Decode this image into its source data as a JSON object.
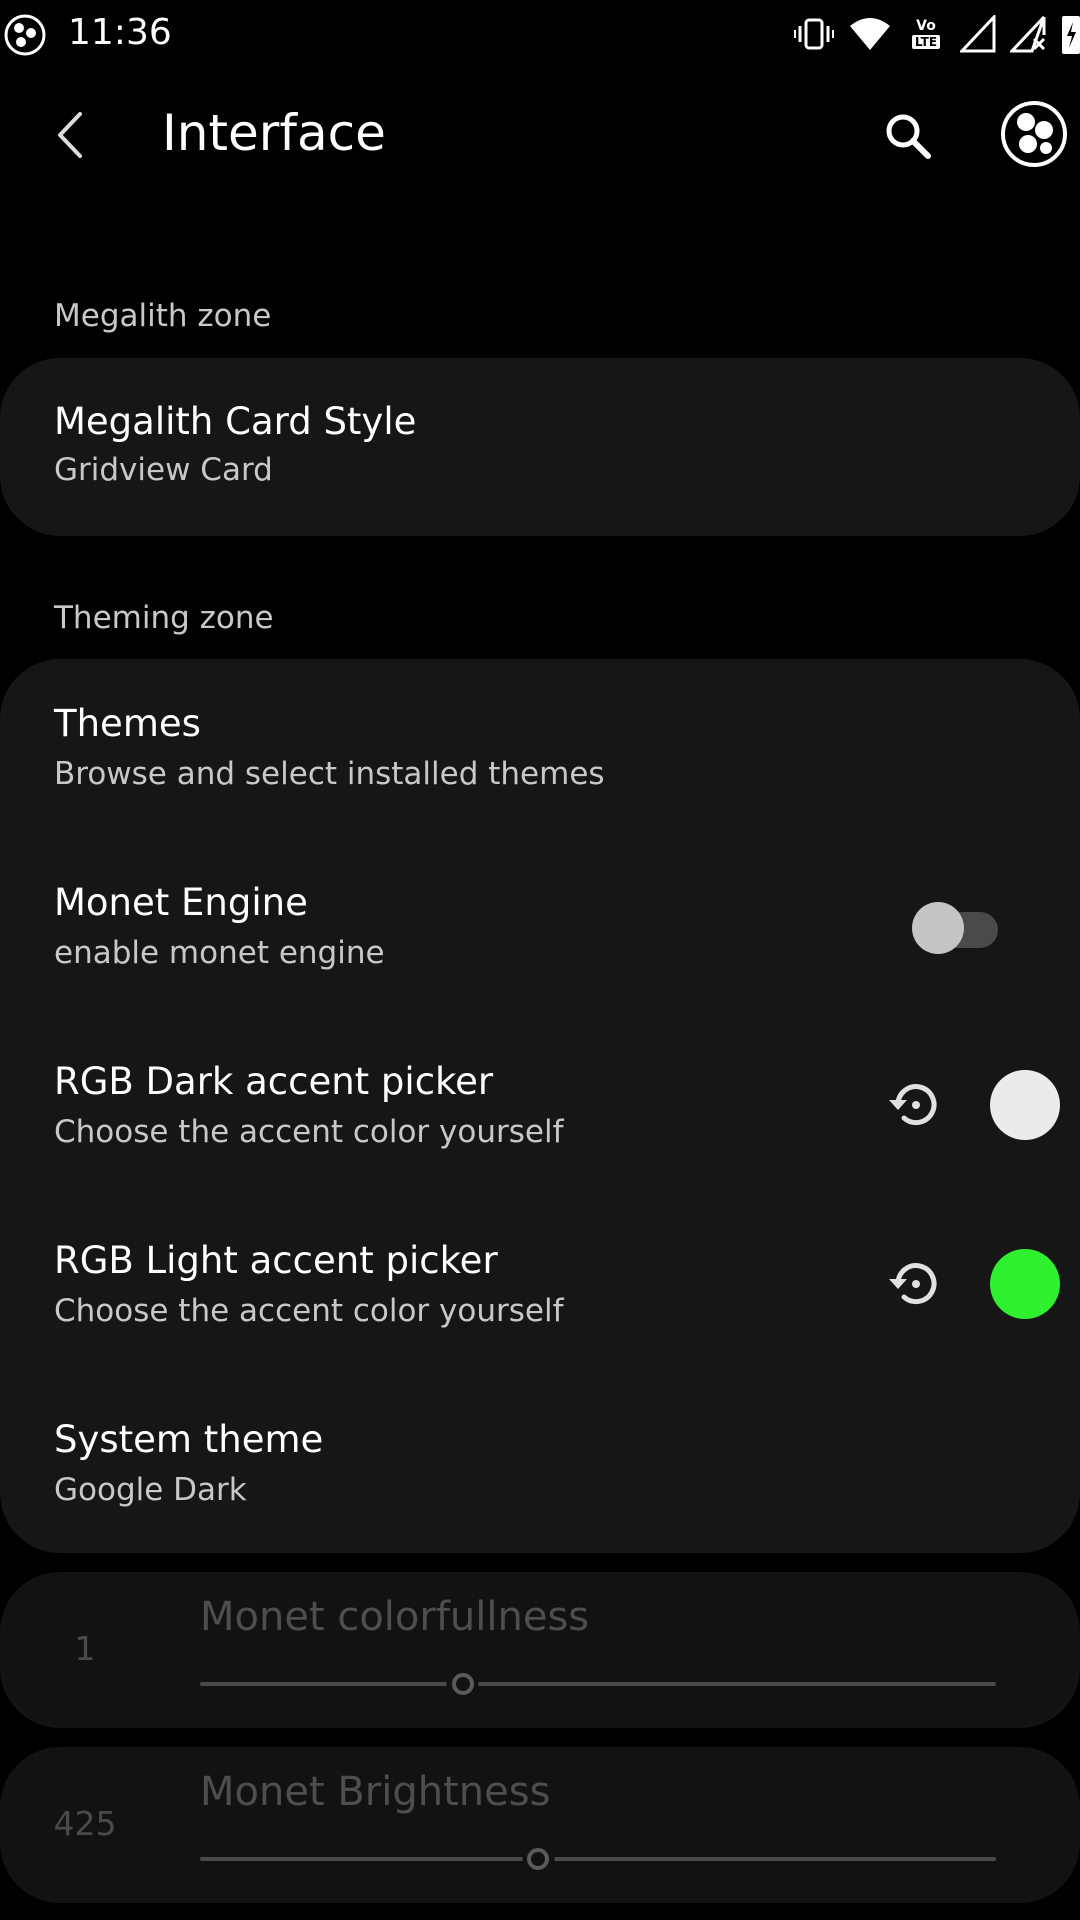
{
  "status_bar": {
    "time": "11:36",
    "volte_label": "Vo",
    "lte_label": "LTE",
    "icons": [
      "app-notification-icon",
      "vibrate-icon",
      "wifi-icon",
      "volte-icon",
      "signal-icon",
      "signal-no-data-icon",
      "battery-charging-icon"
    ]
  },
  "app_bar": {
    "title": "Interface",
    "icons": [
      "back-arrow-icon",
      "search-icon",
      "app-logo-icon"
    ]
  },
  "sections": {
    "megalith": {
      "header": "Megalith zone",
      "items": [
        {
          "title": "Megalith Card Style",
          "summary": "Gridview Card"
        }
      ]
    },
    "theming": {
      "header": "Theming zone",
      "items": [
        {
          "title": "Themes",
          "summary": "Browse and select installed themes"
        },
        {
          "title": "Monet Engine",
          "summary": "enable monet engine",
          "toggle": false
        },
        {
          "title": "RGB Dark accent picker",
          "summary": "Choose the accent color yourself",
          "color": "#ebebeb"
        },
        {
          "title": "RGB Light accent picker",
          "summary": "Choose the accent color yourself",
          "color": "#2ef02e"
        },
        {
          "title": "System theme",
          "summary": "Google Dark"
        }
      ]
    }
  },
  "sliders": [
    {
      "title": "Monet colorfullness",
      "value": "1",
      "fraction": 0.33
    },
    {
      "title": "Monet Brightness",
      "value": "425",
      "fraction": 0.425
    }
  ],
  "colors": {
    "background": "#000000",
    "card": "#161616",
    "disabled_card": "#121212",
    "dark_accent": "#ebebeb",
    "light_accent": "#2ef02e"
  }
}
